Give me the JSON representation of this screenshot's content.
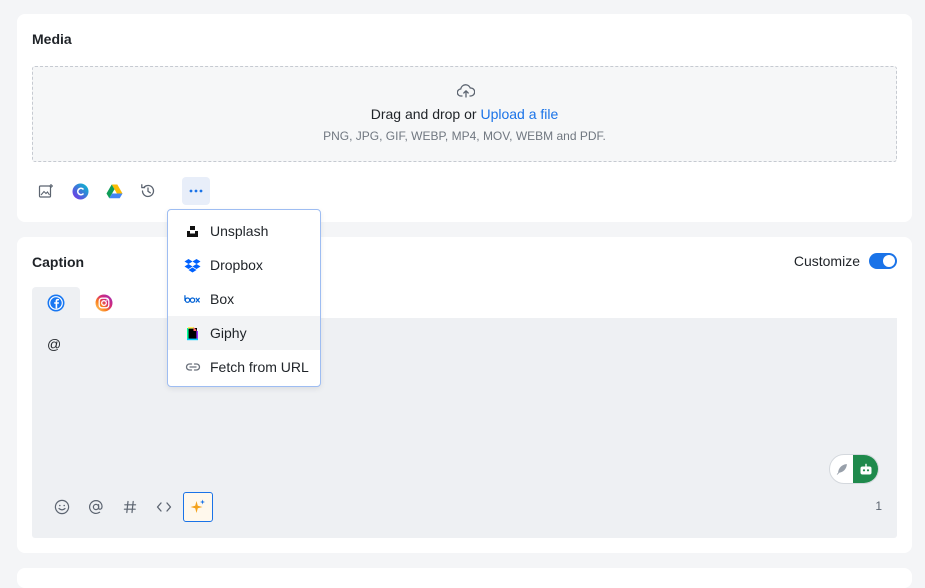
{
  "media": {
    "title": "Media",
    "dropzone": {
      "text": "Drag and drop or",
      "link": "Upload a file",
      "formats": "PNG, JPG, GIF, WEBP, MP4, MOV, WEBM and PDF."
    },
    "tools": [
      "image-library-icon",
      "canva-icon",
      "google-drive-icon",
      "history-icon",
      "more-icon"
    ],
    "more_label": "···"
  },
  "menu": {
    "items": [
      {
        "label": "Unsplash",
        "icon": "unsplash-icon"
      },
      {
        "label": "Dropbox",
        "icon": "dropbox-icon"
      },
      {
        "label": "Box",
        "icon": "box-icon"
      },
      {
        "label": "Giphy",
        "icon": "giphy-icon"
      },
      {
        "label": "Fetch from URL",
        "icon": "link-icon"
      }
    ]
  },
  "caption": {
    "title": "Caption",
    "customize_label": "Customize",
    "customize_on": true,
    "tabs": [
      {
        "network": "facebook",
        "active": true
      },
      {
        "network": "instagram",
        "active": false
      }
    ],
    "text": "@",
    "char_count": "1",
    "toolbar": [
      "emoji-icon",
      "mention-icon",
      "hashtag-icon",
      "code-icon",
      "ai-sparkle-icon"
    ]
  },
  "colors": {
    "accent": "#1a73e8",
    "editor_bg": "#eef0f3",
    "assist_green": "#1f8a4c"
  }
}
